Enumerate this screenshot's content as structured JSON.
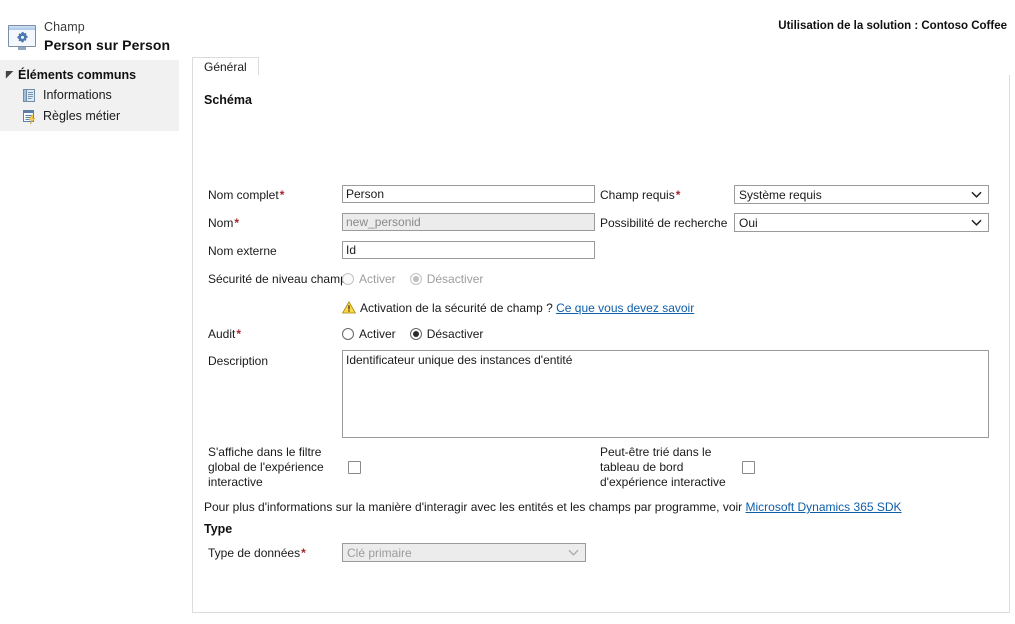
{
  "header": {
    "kicker": "Champ",
    "title": "Person sur Person",
    "solution_label": "Utilisation de la solution : Contoso Coffee",
    "entity_icon": "entity-window-gear-icon"
  },
  "sidebar": {
    "group_label": "Éléments communs",
    "items": [
      {
        "label": "Informations",
        "icon": "information-page-icon"
      },
      {
        "label": "Règles métier",
        "icon": "business-rules-icon"
      }
    ]
  },
  "tabs": [
    {
      "label": "Général",
      "selected": true
    }
  ],
  "form": {
    "sections": {
      "schema": "Schéma",
      "type": "Type"
    },
    "fields": {
      "nom_complet": {
        "label": "Nom complet",
        "required": true,
        "value": "Person",
        "disabled": false
      },
      "nom": {
        "label": "Nom",
        "required": true,
        "value": "new_personid",
        "disabled": true
      },
      "nom_externe": {
        "label": "Nom externe",
        "required": false,
        "value": "Id",
        "disabled": false
      },
      "champ_requis": {
        "label": "Champ requis",
        "required": true,
        "value": "Système requis",
        "disabled": false
      },
      "possibilite_recherche": {
        "label": "Possibilité de recherche",
        "required": false,
        "value": "Oui",
        "disabled": false
      },
      "securite_niveau_champ": {
        "label": "Sécurité de niveau champ",
        "option_enable": "Activer",
        "option_disable": "Désactiver",
        "selected": "Désactiver",
        "disabled": true
      },
      "audit": {
        "label": "Audit",
        "required": true,
        "option_enable": "Activer",
        "option_disable": "Désactiver",
        "selected": "Désactiver",
        "disabled": false
      },
      "description": {
        "label": "Description",
        "value": "Identificateur unique des instances d'entité"
      },
      "filtre_global": {
        "label": "S'affiche dans le filtre global de l'expérience interactive",
        "checked": false
      },
      "tri_tableau_bord": {
        "label": "Peut-être trié dans le tableau de bord d'expérience interactive",
        "checked": false
      },
      "type_donnees": {
        "label": "Type de données",
        "required": true,
        "value": "Clé primaire",
        "disabled": true
      }
    },
    "security_warning": {
      "icon": "warning-triangle-icon",
      "text": "Activation de la sécurité de champ ?",
      "link_text": "Ce que vous devez savoir"
    },
    "sdk_note": {
      "text": "Pour plus d'informations sur la manière d'interagir avec les entités et les champs par programme, voir",
      "link_text": "Microsoft Dynamics 365 SDK"
    }
  },
  "colors": {
    "sidebar_bg": "#f1f1f1",
    "required_asterisk": "#a4262c",
    "link": "#0f5ea8",
    "border": "#9a9a9a",
    "panel_border": "#dcdcdc",
    "disabled_bg": "#ececec"
  }
}
